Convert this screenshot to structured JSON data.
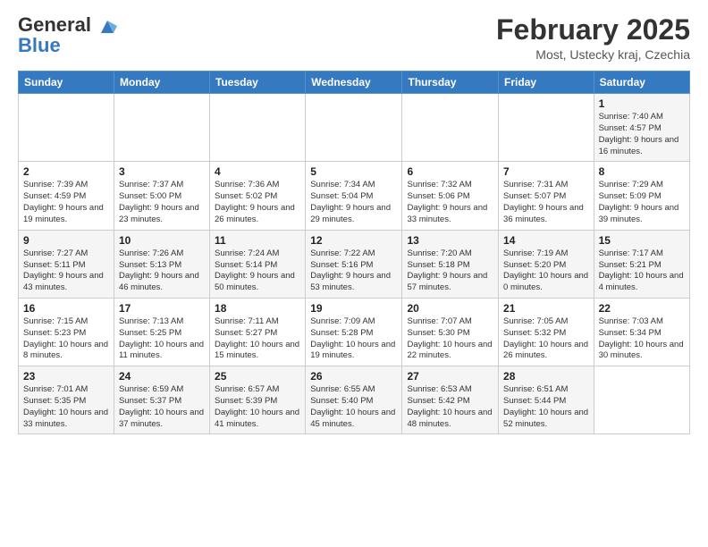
{
  "header": {
    "logo_general": "General",
    "logo_blue": "Blue",
    "month_title": "February 2025",
    "location": "Most, Ustecky kraj, Czechia"
  },
  "weekdays": [
    "Sunday",
    "Monday",
    "Tuesday",
    "Wednesday",
    "Thursday",
    "Friday",
    "Saturday"
  ],
  "weeks": [
    [
      {
        "day": "",
        "info": ""
      },
      {
        "day": "",
        "info": ""
      },
      {
        "day": "",
        "info": ""
      },
      {
        "day": "",
        "info": ""
      },
      {
        "day": "",
        "info": ""
      },
      {
        "day": "",
        "info": ""
      },
      {
        "day": "1",
        "info": "Sunrise: 7:40 AM\nSunset: 4:57 PM\nDaylight: 9 hours and 16 minutes."
      }
    ],
    [
      {
        "day": "2",
        "info": "Sunrise: 7:39 AM\nSunset: 4:59 PM\nDaylight: 9 hours and 19 minutes."
      },
      {
        "day": "3",
        "info": "Sunrise: 7:37 AM\nSunset: 5:00 PM\nDaylight: 9 hours and 23 minutes."
      },
      {
        "day": "4",
        "info": "Sunrise: 7:36 AM\nSunset: 5:02 PM\nDaylight: 9 hours and 26 minutes."
      },
      {
        "day": "5",
        "info": "Sunrise: 7:34 AM\nSunset: 5:04 PM\nDaylight: 9 hours and 29 minutes."
      },
      {
        "day": "6",
        "info": "Sunrise: 7:32 AM\nSunset: 5:06 PM\nDaylight: 9 hours and 33 minutes."
      },
      {
        "day": "7",
        "info": "Sunrise: 7:31 AM\nSunset: 5:07 PM\nDaylight: 9 hours and 36 minutes."
      },
      {
        "day": "8",
        "info": "Sunrise: 7:29 AM\nSunset: 5:09 PM\nDaylight: 9 hours and 39 minutes."
      }
    ],
    [
      {
        "day": "9",
        "info": "Sunrise: 7:27 AM\nSunset: 5:11 PM\nDaylight: 9 hours and 43 minutes."
      },
      {
        "day": "10",
        "info": "Sunrise: 7:26 AM\nSunset: 5:13 PM\nDaylight: 9 hours and 46 minutes."
      },
      {
        "day": "11",
        "info": "Sunrise: 7:24 AM\nSunset: 5:14 PM\nDaylight: 9 hours and 50 minutes."
      },
      {
        "day": "12",
        "info": "Sunrise: 7:22 AM\nSunset: 5:16 PM\nDaylight: 9 hours and 53 minutes."
      },
      {
        "day": "13",
        "info": "Sunrise: 7:20 AM\nSunset: 5:18 PM\nDaylight: 9 hours and 57 minutes."
      },
      {
        "day": "14",
        "info": "Sunrise: 7:19 AM\nSunset: 5:20 PM\nDaylight: 10 hours and 0 minutes."
      },
      {
        "day": "15",
        "info": "Sunrise: 7:17 AM\nSunset: 5:21 PM\nDaylight: 10 hours and 4 minutes."
      }
    ],
    [
      {
        "day": "16",
        "info": "Sunrise: 7:15 AM\nSunset: 5:23 PM\nDaylight: 10 hours and 8 minutes."
      },
      {
        "day": "17",
        "info": "Sunrise: 7:13 AM\nSunset: 5:25 PM\nDaylight: 10 hours and 11 minutes."
      },
      {
        "day": "18",
        "info": "Sunrise: 7:11 AM\nSunset: 5:27 PM\nDaylight: 10 hours and 15 minutes."
      },
      {
        "day": "19",
        "info": "Sunrise: 7:09 AM\nSunset: 5:28 PM\nDaylight: 10 hours and 19 minutes."
      },
      {
        "day": "20",
        "info": "Sunrise: 7:07 AM\nSunset: 5:30 PM\nDaylight: 10 hours and 22 minutes."
      },
      {
        "day": "21",
        "info": "Sunrise: 7:05 AM\nSunset: 5:32 PM\nDaylight: 10 hours and 26 minutes."
      },
      {
        "day": "22",
        "info": "Sunrise: 7:03 AM\nSunset: 5:34 PM\nDaylight: 10 hours and 30 minutes."
      }
    ],
    [
      {
        "day": "23",
        "info": "Sunrise: 7:01 AM\nSunset: 5:35 PM\nDaylight: 10 hours and 33 minutes."
      },
      {
        "day": "24",
        "info": "Sunrise: 6:59 AM\nSunset: 5:37 PM\nDaylight: 10 hours and 37 minutes."
      },
      {
        "day": "25",
        "info": "Sunrise: 6:57 AM\nSunset: 5:39 PM\nDaylight: 10 hours and 41 minutes."
      },
      {
        "day": "26",
        "info": "Sunrise: 6:55 AM\nSunset: 5:40 PM\nDaylight: 10 hours and 45 minutes."
      },
      {
        "day": "27",
        "info": "Sunrise: 6:53 AM\nSunset: 5:42 PM\nDaylight: 10 hours and 48 minutes."
      },
      {
        "day": "28",
        "info": "Sunrise: 6:51 AM\nSunset: 5:44 PM\nDaylight: 10 hours and 52 minutes."
      },
      {
        "day": "",
        "info": ""
      }
    ]
  ]
}
